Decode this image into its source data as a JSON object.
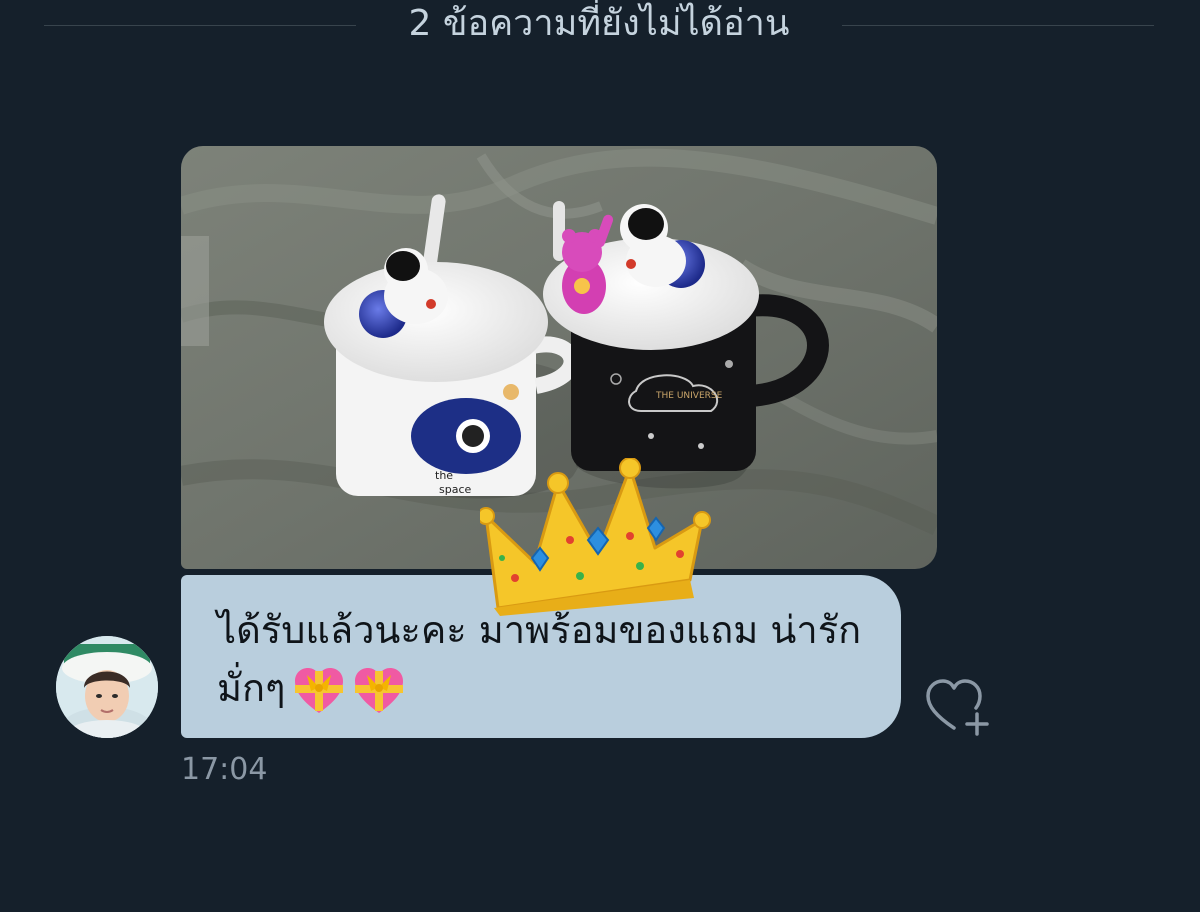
{
  "conversation": {
    "unread_divider": "2 ข้อความที่ยังไม่ได้อ่าน"
  },
  "message": {
    "text": "ได้รับแล้วนะคะ มาพร้อมของแถม น่ารักมั่กๆ",
    "timestamp": "17:04",
    "emoji": [
      "gift-heart-icon",
      "gift-heart-icon"
    ],
    "sticker": "crown-icon"
  },
  "actions": {
    "like": "heart-plus-icon"
  },
  "colors": {
    "background": "#15202b",
    "bubble": "#b9cedd",
    "divider": "#38444d",
    "muted_text": "#8b98a5"
  }
}
